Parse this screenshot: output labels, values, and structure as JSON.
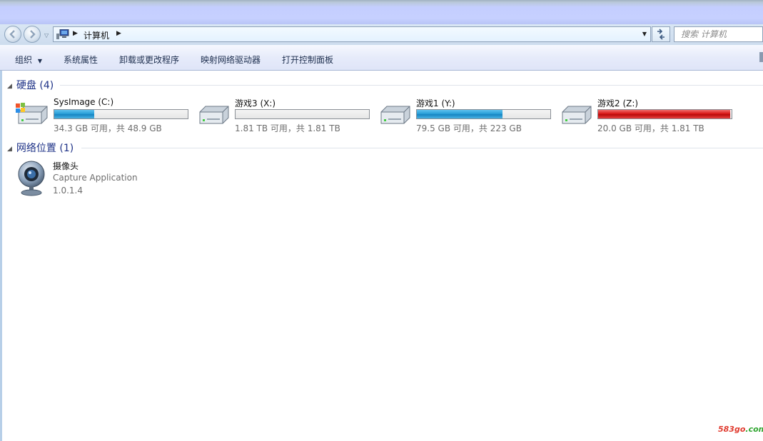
{
  "nav": {
    "crumb": "计算机",
    "search_placeholder": "搜索 计算机"
  },
  "toolbar": {
    "organize": "组织",
    "system_properties": "系统属性",
    "uninstall": "卸载或更改程序",
    "map_drive": "映射网络驱动器",
    "control_panel": "打开控制面板"
  },
  "groups": {
    "hard_disks": "硬盘 (4)",
    "network": "网络位置 (1)"
  },
  "drives": [
    {
      "name": "SysImage (C:)",
      "free_text": "34.3 GB 可用，共 48.9 GB",
      "used_fraction": 0.3,
      "bar_color": "#2a9fd8",
      "icon": "windows-drive-icon"
    },
    {
      "name": "游戏3 (X:)",
      "free_text": "1.81 TB 可用，共 1.81 TB",
      "used_fraction": 0.0,
      "bar_color": "#2a9fd8",
      "icon": "hard-drive-icon"
    },
    {
      "name": "游戏1 (Y:)",
      "free_text": "79.5 GB 可用，共 223 GB",
      "used_fraction": 0.64,
      "bar_color": "#2a9fd8",
      "icon": "hard-drive-icon"
    },
    {
      "name": "游戏2 (Z:)",
      "free_text": "20.0 GB 可用，共 1.81 TB",
      "used_fraction": 0.99,
      "bar_color": "#d81818",
      "icon": "hard-drive-icon"
    }
  ],
  "network_item": {
    "name": "摄像头",
    "type": "Capture Application",
    "version": "1.0.1.4",
    "icon": "webcam-icon"
  },
  "watermark": {
    "prefix": "583go",
    "suffix": ".com"
  }
}
